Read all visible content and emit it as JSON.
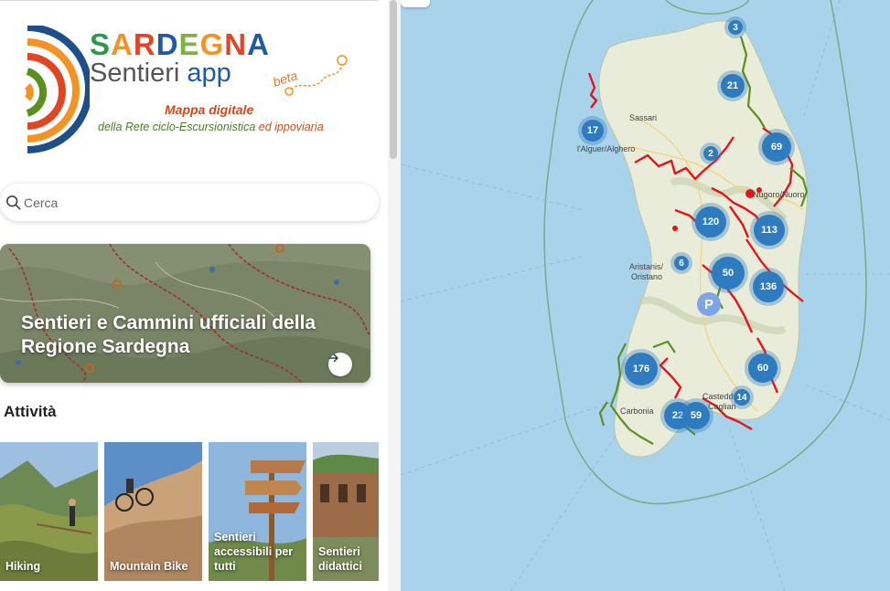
{
  "logo": {
    "title_letters": [
      {
        "ch": "S",
        "color": "#2e9a49"
      },
      {
        "ch": "A",
        "color": "#f29324"
      },
      {
        "ch": "R",
        "color": "#e04623"
      },
      {
        "ch": "D",
        "color": "#1f5aa6"
      },
      {
        "ch": "E",
        "color": "#7bb244"
      },
      {
        "ch": "G",
        "color": "#f29324"
      },
      {
        "ch": "N",
        "color": "#e04623"
      },
      {
        "ch": "A",
        "color": "#1f5aa6"
      }
    ],
    "subtitle_a": "Sentieri ",
    "subtitle_b": "app",
    "beta": "beta",
    "tagline": "Mappa digitale",
    "rete_a": "della Rete ciclo-Escursionistica ",
    "rete_b": "ed ippoviaria"
  },
  "search": {
    "placeholder": "Cerca"
  },
  "hero": {
    "title": "Sentieri e Cammini ufficiali della Regione Sardegna"
  },
  "activities": {
    "title": "Attività",
    "items": [
      {
        "label": "Hiking"
      },
      {
        "label": "Mountain Bike"
      },
      {
        "label": "Sentieri accessibili per tutti"
      },
      {
        "label": "Sentieri didattici"
      }
    ]
  },
  "map": {
    "places": [
      {
        "name": "Sassari"
      },
      {
        "name": "l'Alguer/Alghero"
      },
      {
        "name": "Nugoro/Nuoro"
      },
      {
        "name": "Aristanis/"
      },
      {
        "name": "Oristano"
      },
      {
        "name": "Carbonia"
      },
      {
        "name": "Casteddu/"
      },
      {
        "name": "Cagliari"
      }
    ],
    "clusters": [
      {
        "count": "3"
      },
      {
        "count": "21"
      },
      {
        "count": "17"
      },
      {
        "count": "2"
      },
      {
        "count": "69"
      },
      {
        "count": "120"
      },
      {
        "count": "113"
      },
      {
        "count": "6"
      },
      {
        "count": "50"
      },
      {
        "count": "136"
      },
      {
        "count": "176"
      },
      {
        "count": "60"
      },
      {
        "count": "14"
      },
      {
        "count": "22"
      },
      {
        "count": "59"
      }
    ],
    "parking_label": "P",
    "colors": {
      "sea": "#a9d3ea",
      "land": "#e8ecd9",
      "cluster": "#2f7bbf",
      "trail_red": "#e3141b",
      "trail_green": "#5b8f1f"
    }
  }
}
